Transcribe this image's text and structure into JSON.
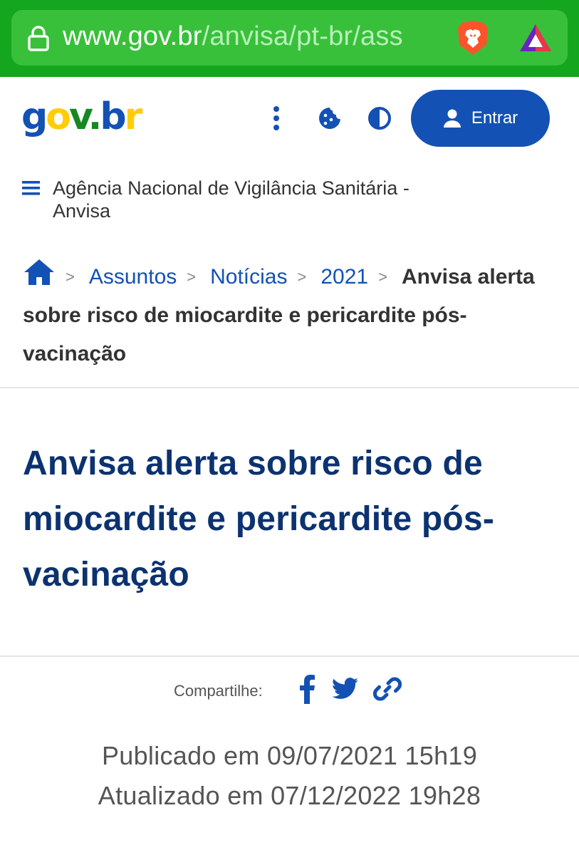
{
  "browser": {
    "url_host": "www.gov.br",
    "url_path": "/anvisa/pt-br/ass"
  },
  "colors": {
    "browser_bar": "#14a61e",
    "gov_blue": "#1351b4",
    "title_blue": "#0c326f",
    "text": "#333333"
  },
  "header": {
    "logo": {
      "g": "g",
      "o": "o",
      "v": "v",
      "dot": ".",
      "b": "b",
      "r": "r"
    },
    "icons": [
      "more-vertical-icon",
      "cookie-icon",
      "contrast-icon"
    ],
    "login_label": "Entrar"
  },
  "site": {
    "name": "Agência Nacional de Vigilância Sanitária - Anvisa"
  },
  "breadcrumb": {
    "items": [
      "Assuntos",
      "Notícias",
      "2021"
    ],
    "separator": ">",
    "current": "Anvisa alerta sobre risco de miocardite e pericardite pós-vacinação"
  },
  "article": {
    "title": "Anvisa alerta sobre risco de miocardite e pericardite pós-vacinação",
    "share_label": "Compartilhe:",
    "published": "Publicado em 09/07/2021 15h19",
    "updated": "Atualizado em 07/12/2022 19h28"
  }
}
